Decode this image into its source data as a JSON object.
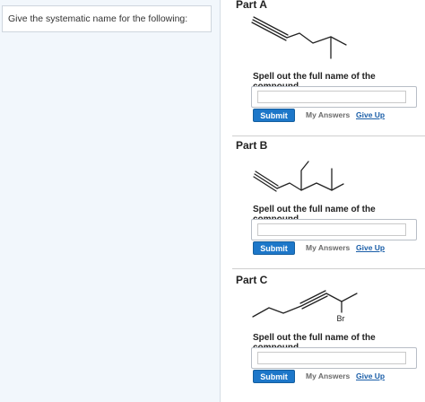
{
  "question": {
    "prompt": "Give the systematic name for the following:"
  },
  "instruction": "Spell out the full name of the compound.",
  "parts": [
    {
      "title": "Part A",
      "input_value": "",
      "submit_label": "Submit",
      "my_answers_label": "My Answers",
      "give_up_label": "Give Up"
    },
    {
      "title": "Part B",
      "input_value": "",
      "submit_label": "Submit",
      "my_answers_label": "My Answers",
      "give_up_label": "Give Up"
    },
    {
      "title": "Part C",
      "input_value": "",
      "submit_label": "Submit",
      "my_answers_label": "My Answers",
      "give_up_label": "Give Up",
      "substituent_label": "Br"
    }
  ],
  "colors": {
    "accent": "#1d77c9",
    "link": "#1a5ea8",
    "left_panel_bg": "#f2f7fc"
  }
}
